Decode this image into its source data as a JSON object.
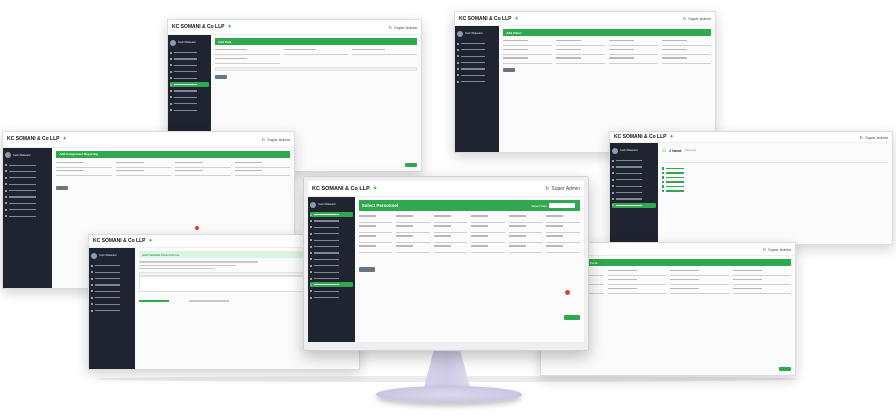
{
  "brand": {
    "name": "KC SOMANI & Co LLP",
    "accent": "#2fa84f",
    "sidebar_bg": "#1f2430"
  },
  "user": {
    "label": "Super Admin",
    "icon": "refresh-icon"
  },
  "sidebar_user": "Sushi Balasaini",
  "panels": {
    "top_left": {
      "header": "Add Task"
    },
    "top_right": {
      "header": "Add Client"
    },
    "mid_left": {
      "header": "Add Assignment Reporting"
    },
    "mid_right": {
      "header": "2 Name",
      "subheader": "Client List"
    },
    "bottom_left": {
      "header": "Add Detailed Task Actions"
    },
    "bottom_right": {
      "header": "Add Assignment Completion Form"
    },
    "center": {
      "header": "Select Personnel",
      "header_right": "Select Date"
    }
  },
  "icons": [
    "leaf-icon",
    "refresh-icon",
    "user-avatar-icon",
    "delete-icon",
    "home-icon"
  ]
}
